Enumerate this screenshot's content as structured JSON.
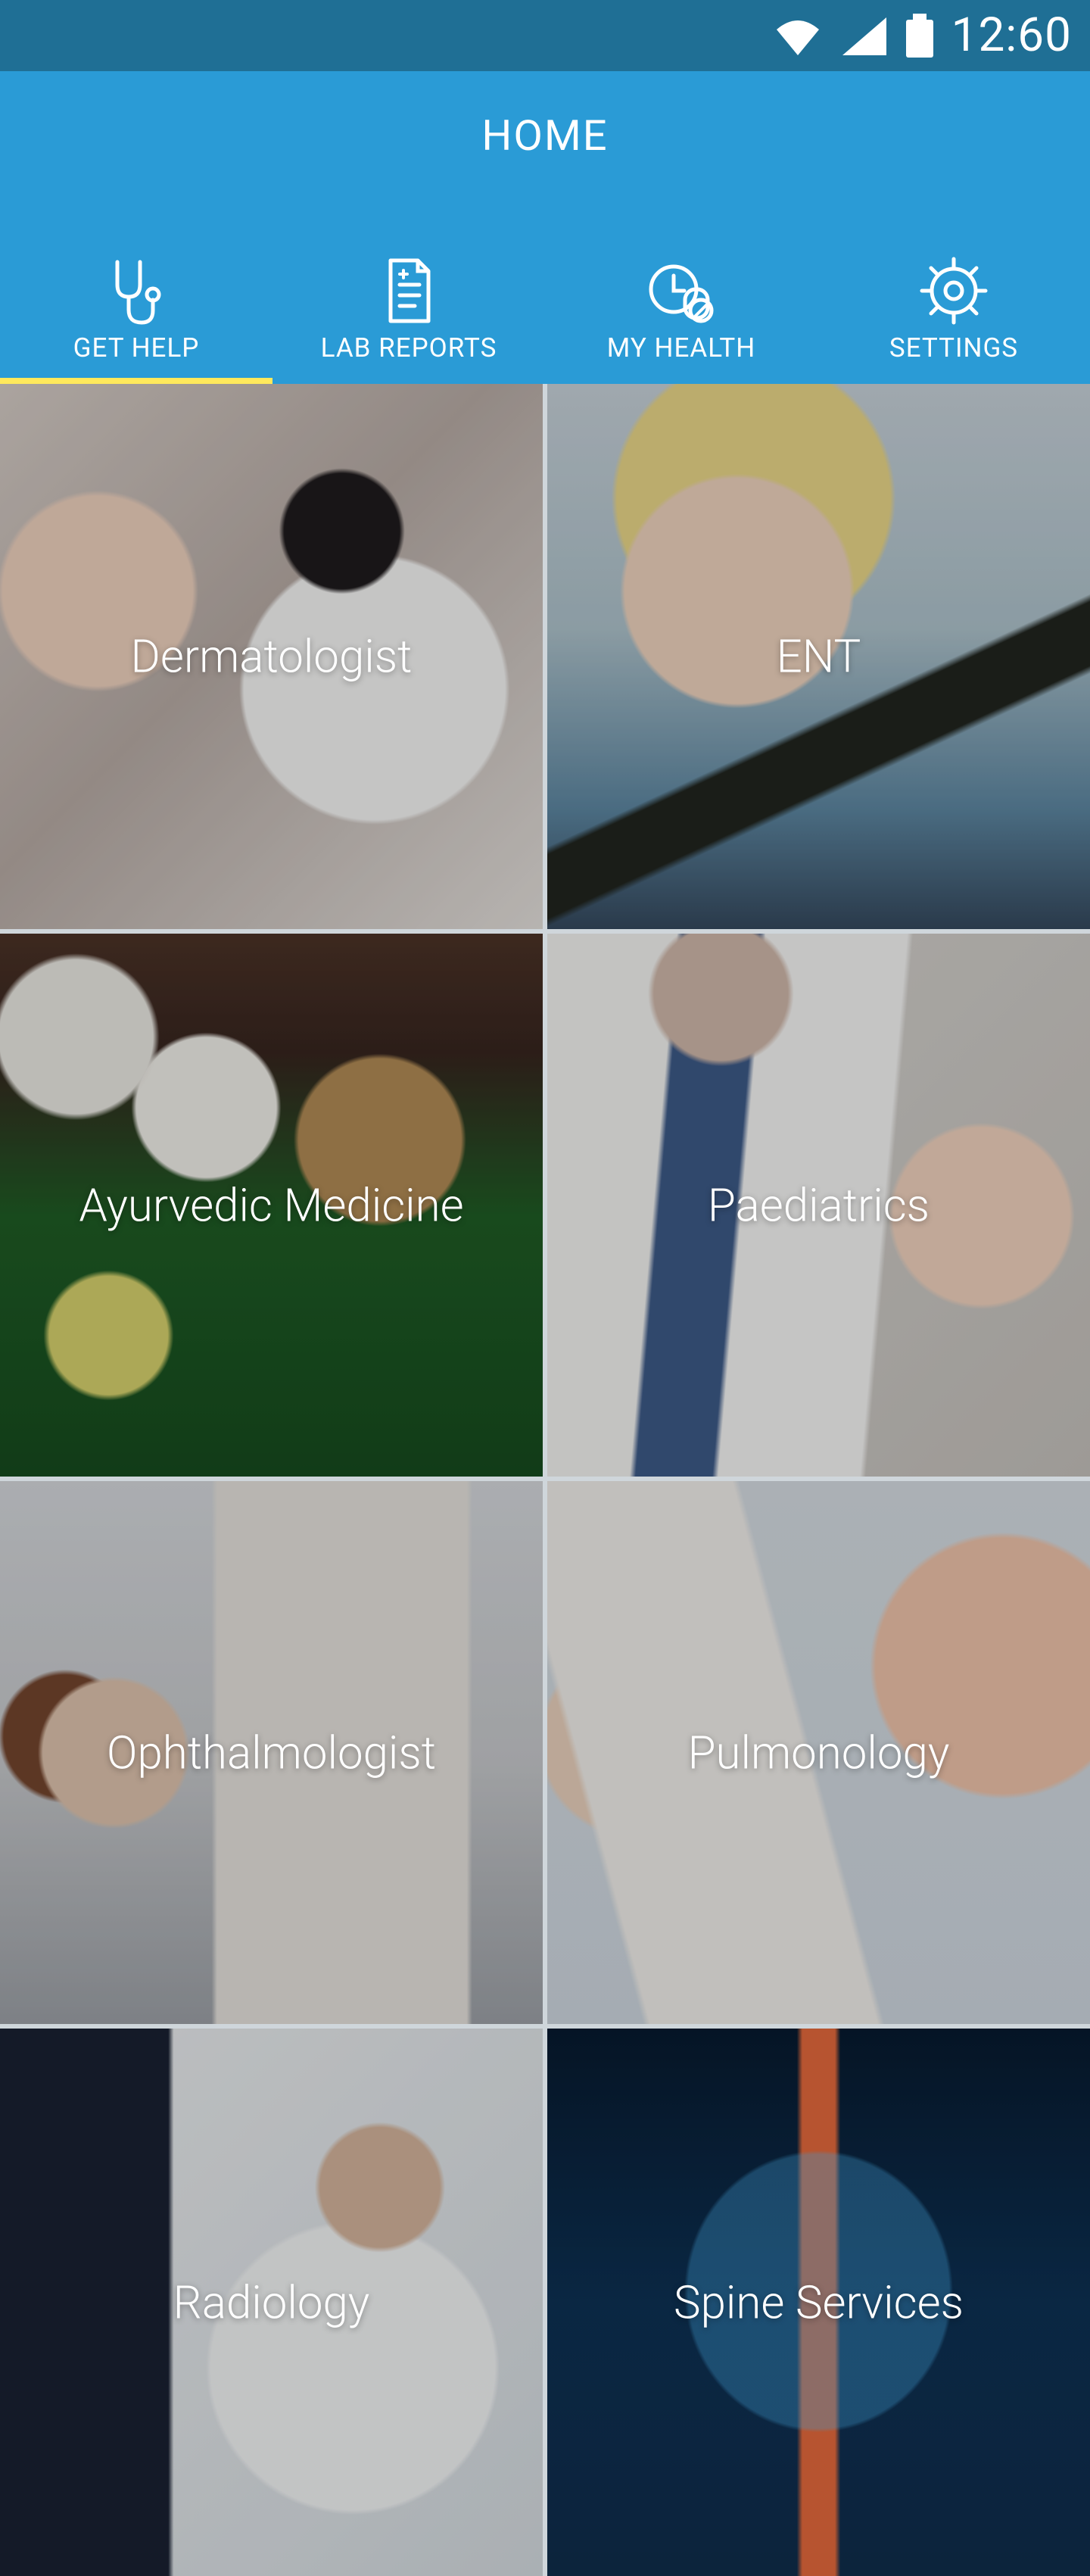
{
  "status_bar": {
    "time": "12:60"
  },
  "header": {
    "title": "HOME"
  },
  "tabs": [
    {
      "label": "GET HELP",
      "icon": "stethoscope-icon",
      "selected": true
    },
    {
      "label": "LAB REPORTS",
      "icon": "report-icon",
      "selected": false
    },
    {
      "label": "MY HEALTH",
      "icon": "clock-pill-icon",
      "selected": false
    },
    {
      "label": "SETTINGS",
      "icon": "gear-icon",
      "selected": false
    }
  ],
  "services": [
    {
      "label": "Dermatologist"
    },
    {
      "label": "ENT"
    },
    {
      "label": "Ayurvedic Medicine"
    },
    {
      "label": "Paediatrics"
    },
    {
      "label": "Ophthalmologist"
    },
    {
      "label": "Pulmonology"
    },
    {
      "label": "Radiology"
    },
    {
      "label": "Spine Services"
    }
  ],
  "colors": {
    "status_bar": "#1f6f95",
    "header": "#2a9bd6",
    "tab_indicator": "#ffe95c"
  }
}
